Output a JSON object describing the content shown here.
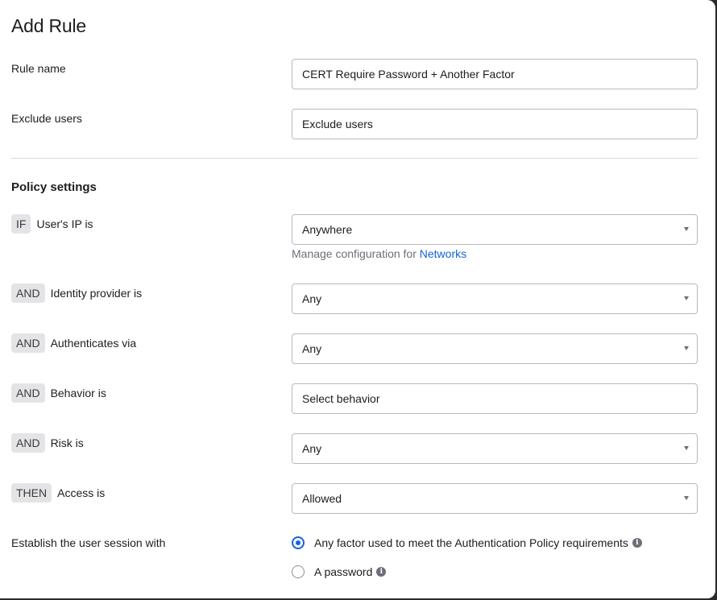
{
  "dialog": {
    "title": "Add Rule"
  },
  "rule_name": {
    "label": "Rule name",
    "value": "CERT Require Password + Another Factor"
  },
  "exclude_users": {
    "label": "Exclude users",
    "placeholder": "Exclude users"
  },
  "policy_settings": {
    "title": "Policy settings",
    "conditions": [
      {
        "keyword": "IF",
        "label": "User's IP is",
        "value": "Anywhere",
        "type": "select"
      },
      {
        "keyword": "AND",
        "label": "Identity provider is",
        "value": "Any",
        "type": "select"
      },
      {
        "keyword": "AND",
        "label": "Authenticates via",
        "value": "Any",
        "type": "select"
      },
      {
        "keyword": "AND",
        "label": "Behavior is",
        "value": "Select behavior",
        "type": "input"
      },
      {
        "keyword": "AND",
        "label": "Risk is",
        "value": "Any",
        "type": "select"
      },
      {
        "keyword": "THEN",
        "label": "Access is",
        "value": "Allowed",
        "type": "select"
      }
    ],
    "network_helper": {
      "text": "Manage configuration for ",
      "link": "Networks"
    }
  },
  "session": {
    "label": "Establish the user session with",
    "options": [
      {
        "label": "Any factor used to meet the Authentication Policy requirements",
        "selected": true
      },
      {
        "label": "A password",
        "selected": false
      }
    ]
  },
  "colors": {
    "accent": "#1662dd",
    "pill_bg": "#e4e4e7",
    "border": "#b7b9c1"
  },
  "icons": {
    "info": "info-icon",
    "caret": "chevron-down-icon"
  }
}
